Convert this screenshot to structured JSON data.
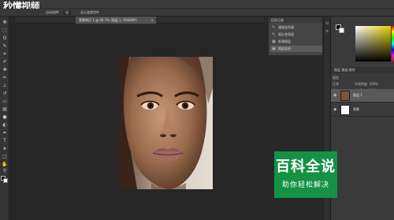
{
  "logo": {
    "text": "秒懂视频"
  },
  "options_bar": {
    "auto_select_label": "自动选择:",
    "auto_select_value": "组",
    "transform_label": "显示变换控件"
  },
  "document_tab": {
    "label": "背景拷贝 1 @ 66.7% (图层 1, RGB/8#)",
    "close": "×"
  },
  "history_panel": {
    "title": "历史记录",
    "items": [
      {
        "label": "通道混合器",
        "icon": "brush-icon"
      },
      {
        "label": "高反差保留",
        "icon": "brush-icon"
      },
      {
        "label": "新建图层",
        "icon": "layer-icon"
      },
      {
        "label": "图层混合",
        "icon": "layer-icon",
        "active": true
      }
    ]
  },
  "layers_panel": {
    "tabs": "图层  通道  路径",
    "kind_label": "类型",
    "blend_mode": "正常",
    "opacity_label": "不透明度: 100%",
    "lock_label": "锁定:",
    "fill_label": "填充: 100%",
    "layers": [
      {
        "name": "图层 1",
        "active": true,
        "thumb": "face"
      },
      {
        "name": "背景",
        "active": false,
        "thumb": "white"
      }
    ]
  },
  "watermark": {
    "title": "百科全说",
    "subtitle": "助你轻松解决",
    "color": "#14964a"
  }
}
